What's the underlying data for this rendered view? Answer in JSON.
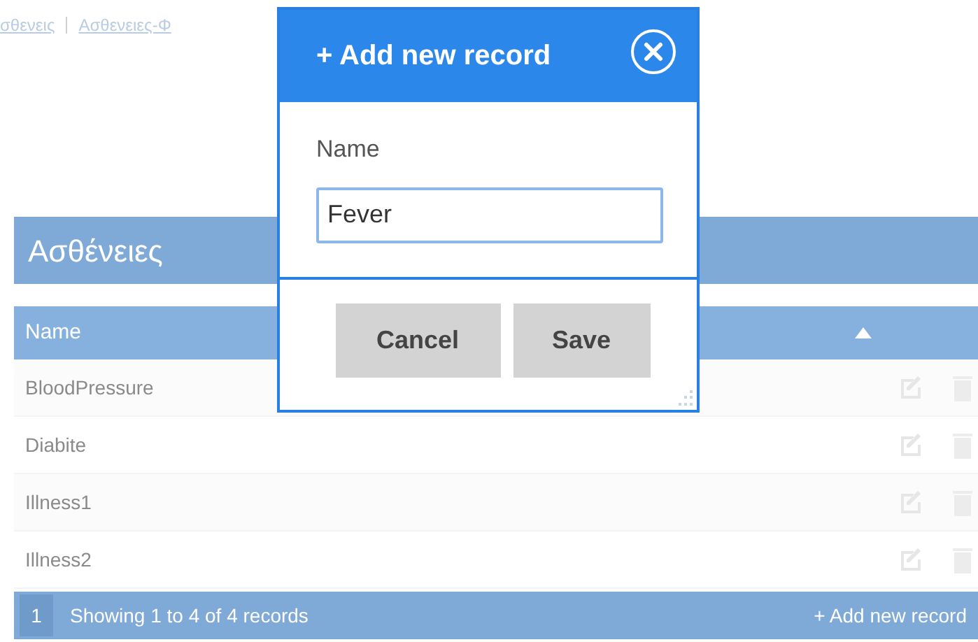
{
  "breadcrumb": [
    {
      "label": "σθενεις"
    },
    {
      "label": "Ασθενειες-Φ"
    }
  ],
  "panel": {
    "title": "Ασθένειες"
  },
  "table": {
    "columns": [
      {
        "label": "Name",
        "sorted": true
      }
    ],
    "rows": [
      {
        "name": "BloodPressure"
      },
      {
        "name": "Diabite"
      },
      {
        "name": "Illness1"
      },
      {
        "name": "Illness2"
      }
    ]
  },
  "footer": {
    "page": "1",
    "info": "Showing 1 to 4 of 4 records",
    "add": "+ Add new record"
  },
  "dialog": {
    "title": "+ Add new record",
    "field": {
      "label": "Name",
      "value": "Fever"
    },
    "buttons": [
      "Cancel",
      "Save"
    ]
  }
}
